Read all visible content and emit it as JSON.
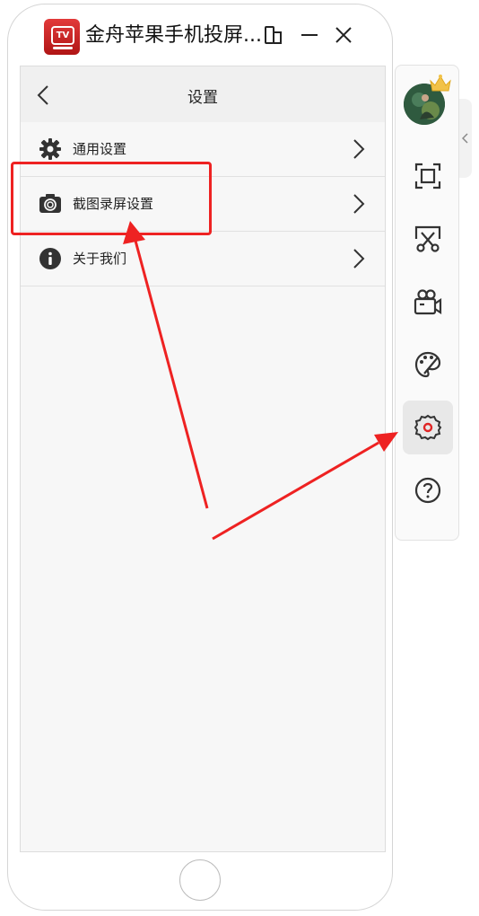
{
  "window": {
    "title": "金舟苹果手机投屏...",
    "logo_text": "TV"
  },
  "nav": {
    "title": "设置"
  },
  "menu": {
    "items": [
      {
        "label": "通用设置",
        "icon": "gear-icon"
      },
      {
        "label": "截图录屏设置",
        "icon": "camera-icon"
      },
      {
        "label": "关于我们",
        "icon": "info-icon"
      }
    ]
  },
  "toolbar": {
    "items": [
      "fullscreen-icon",
      "screenshot-icon",
      "video-record-icon",
      "palette-icon",
      "settings-icon",
      "help-icon"
    ],
    "active": "settings-icon"
  },
  "colors": {
    "accent": "#ee2222",
    "logo": "#d42a2a"
  }
}
